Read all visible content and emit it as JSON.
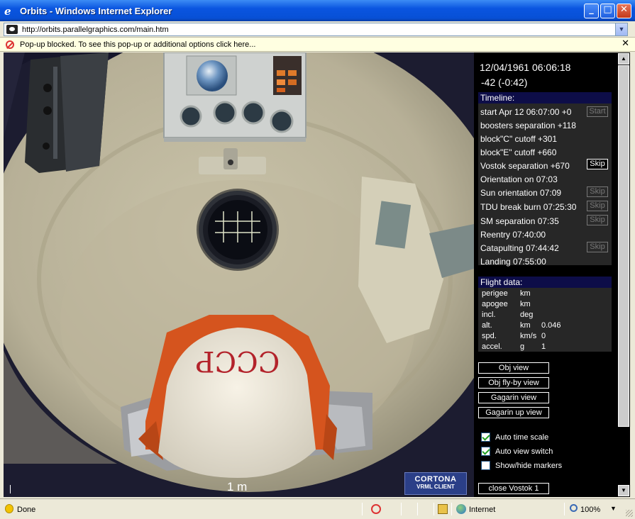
{
  "window": {
    "title": "Orbits - Windows Internet Explorer",
    "minimize": "_",
    "maximize": "□",
    "close": "✕"
  },
  "address": {
    "url": "http://orbits.parallelgraphics.com/main.htm",
    "dropdown": "▼"
  },
  "infobar": {
    "message": "Pop-up blocked. To see this pop-up or additional options click here...",
    "close": "✕"
  },
  "scene": {
    "scale_label": "1 m",
    "helmet_text": "СССР",
    "logo_line1": "CORTONA",
    "logo_line2": "VRML CLIENT",
    "colors": {
      "wall": "#b9b39a",
      "helmet": "#ece6d6",
      "suit_orange": "#d5541e",
      "helmet_text": "#b3232b"
    }
  },
  "panel": {
    "datetime": "12/04/1961 06:06:18",
    "offset": "-42 (-0:42)",
    "timeline": {
      "header": "Timeline:",
      "rows": [
        {
          "label": "start Apr 12 06:07:00 +0",
          "button": "Start",
          "active": false
        },
        {
          "label": "boosters separation +118",
          "button": ""
        },
        {
          "label": "block\"C\" cutoff +301",
          "button": ""
        },
        {
          "label": "block\"E\" cutoff +660",
          "button": ""
        },
        {
          "label": "Vostok separation +670",
          "button": "Skip",
          "active": true
        },
        {
          "label": "Orientation on 07:03",
          "button": ""
        },
        {
          "label": "Sun orientation 07:09",
          "button": "Skip",
          "active": false
        },
        {
          "label": "TDU break burn 07:25:30",
          "button": "Skip",
          "active": false
        },
        {
          "label": "SM separation 07:35",
          "button": "Skip",
          "active": false
        },
        {
          "label": "Reentry 07:40:00",
          "button": ""
        },
        {
          "label": "Catapulting 07:44:42",
          "button": "Skip",
          "active": false
        },
        {
          "label": "Landing 07:55:00",
          "button": ""
        }
      ]
    },
    "flight_data": {
      "header": "Flight data:",
      "rows": [
        {
          "name": "perigee",
          "unit": "km",
          "value": ""
        },
        {
          "name": "apogee",
          "unit": "km",
          "value": ""
        },
        {
          "name": "incl.",
          "unit": "deg",
          "value": ""
        },
        {
          "name": "alt.",
          "unit": "km",
          "value": "0.046"
        },
        {
          "name": "spd.",
          "unit": "km/s",
          "value": "0"
        },
        {
          "name": "accel.",
          "unit": "g",
          "value": "1"
        }
      ]
    },
    "views": [
      "Obj view",
      "Obj fly-by view",
      "Gagarin view",
      "Gagarin up view"
    ],
    "checkboxes": [
      {
        "label": "Auto time scale",
        "checked": true
      },
      {
        "label": "Auto view switch",
        "checked": true
      },
      {
        "label": "Show/hide markers",
        "checked": false
      }
    ],
    "close_button": "close Vostok 1"
  },
  "scrollbar": {
    "up": "▲",
    "down": "▼"
  },
  "status": {
    "done": "Done",
    "zone": "Internet",
    "zoom": "100%",
    "zoom_caret": "▼"
  }
}
